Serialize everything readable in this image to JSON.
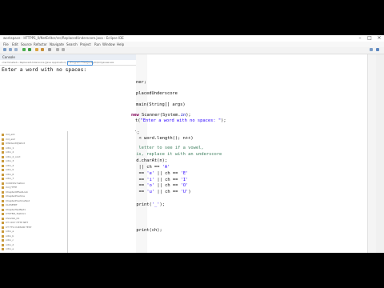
{
  "window": {
    "title": "workspace - HTTPPS_0/NetEditor/src/ReplacedUnderscore.java - Eclipse IDE"
  },
  "menubar": {
    "items": [
      "File",
      "Edit",
      "Source",
      "Refactor",
      "Navigate",
      "Search",
      "Project",
      "Run",
      "Window",
      "Help"
    ]
  },
  "console": {
    "tab_label": "Console",
    "path": "<terminated> ReplacedUnderscore [Java Application] C:\\Program Files\\Java\\jdk\\bin\\javaw.exe",
    "output": "Enter a word with no spaces:"
  },
  "explorer": {
    "items": [
      "md_ex1",
      "md_ex2",
      "UWIdentifyWord",
      "nitro_1",
      "nitro_2",
      "nitro_2_cont",
      "nitro_3",
      "nitro_4",
      "nitro_5",
      "nitro_6",
      "nitro_7",
      "md4Information",
      "md_HTTP",
      "ChapterOffsetLook",
      "ChapterPractice",
      "ChapterPracticeTest",
      "CLOSEBIT",
      "ChapterTestNet1",
      "CTCTBD_Test2x1",
      "CS12GS_01",
      "CT 1917 HTTP NET",
      "CT TTS CURSOR TEST",
      "nitro_a",
      "nitro_b",
      "nitro_c",
      "nitro_d",
      "nitro_e"
    ]
  },
  "editor": {
    "top_fragments": [
      "ner;",
      "placedUnderscore",
      "main(String[] args)"
    ],
    "scanner_kw": "new",
    "scanner_rest": " Scanner(System.",
    "scanner_field": "in",
    "scanner_end": ");",
    "print_prefix": "t(",
    "print_string": "\"Enter a word with no spaces: \"",
    "print_end": ");",
    "close_fragment": ");",
    "loop_fragment": "n < word.length(); n++)",
    "lines": [
      {
        "num": "14",
        "comment": "// Check each letter to see if a vowel,"
      },
      {
        "num": "15",
        "comment": "// and if it is, replace it with an underscore"
      },
      {
        "num": "16",
        "kw": "char",
        "rest": " ch = word.charAt(n);"
      },
      {
        "num": "17",
        "kw": "if",
        "rest": " (ch == ",
        "s1": "'a'",
        "mid": " || ch == ",
        "s2": "'A'"
      },
      {
        "num": "18",
        "rest": "    || ch == ",
        "s1": "'e'",
        "mid": " || ch == ",
        "s2": "'E'"
      },
      {
        "num": "19",
        "rest": "    || ch == ",
        "s1": "'i'",
        "mid": " || ch == ",
        "s2": "'I'"
      },
      {
        "num": "20",
        "rest": "    || ch == ",
        "s1": "'o'",
        "mid": " || ch == ",
        "s2": "'O'"
      },
      {
        "num": "21",
        "rest": "    || ch == ",
        "s1": "'u'",
        "mid": " || ch == ",
        "s2": "'U'",
        "end": ")"
      },
      {
        "num": "22",
        "rest": "{"
      },
      {
        "num": "23",
        "pre": "System.",
        "fld": "out",
        "rest": ".print(",
        "s1": "'_'",
        "end": ");"
      },
      {
        "num": "24",
        "rest": "}"
      },
      {
        "num": "25",
        "kw": "else"
      },
      {
        "num": "26",
        "rest": "{"
      },
      {
        "num": "27",
        "pre": "System.",
        "fld": "out",
        "rest": ".print(ch);"
      },
      {
        "num": "28",
        "rest": "}"
      },
      {
        "num": "29",
        "rest": "}"
      },
      {
        "num": "30",
        "rest": "}"
      },
      {
        "num": "31",
        "rest": "}"
      }
    ]
  }
}
